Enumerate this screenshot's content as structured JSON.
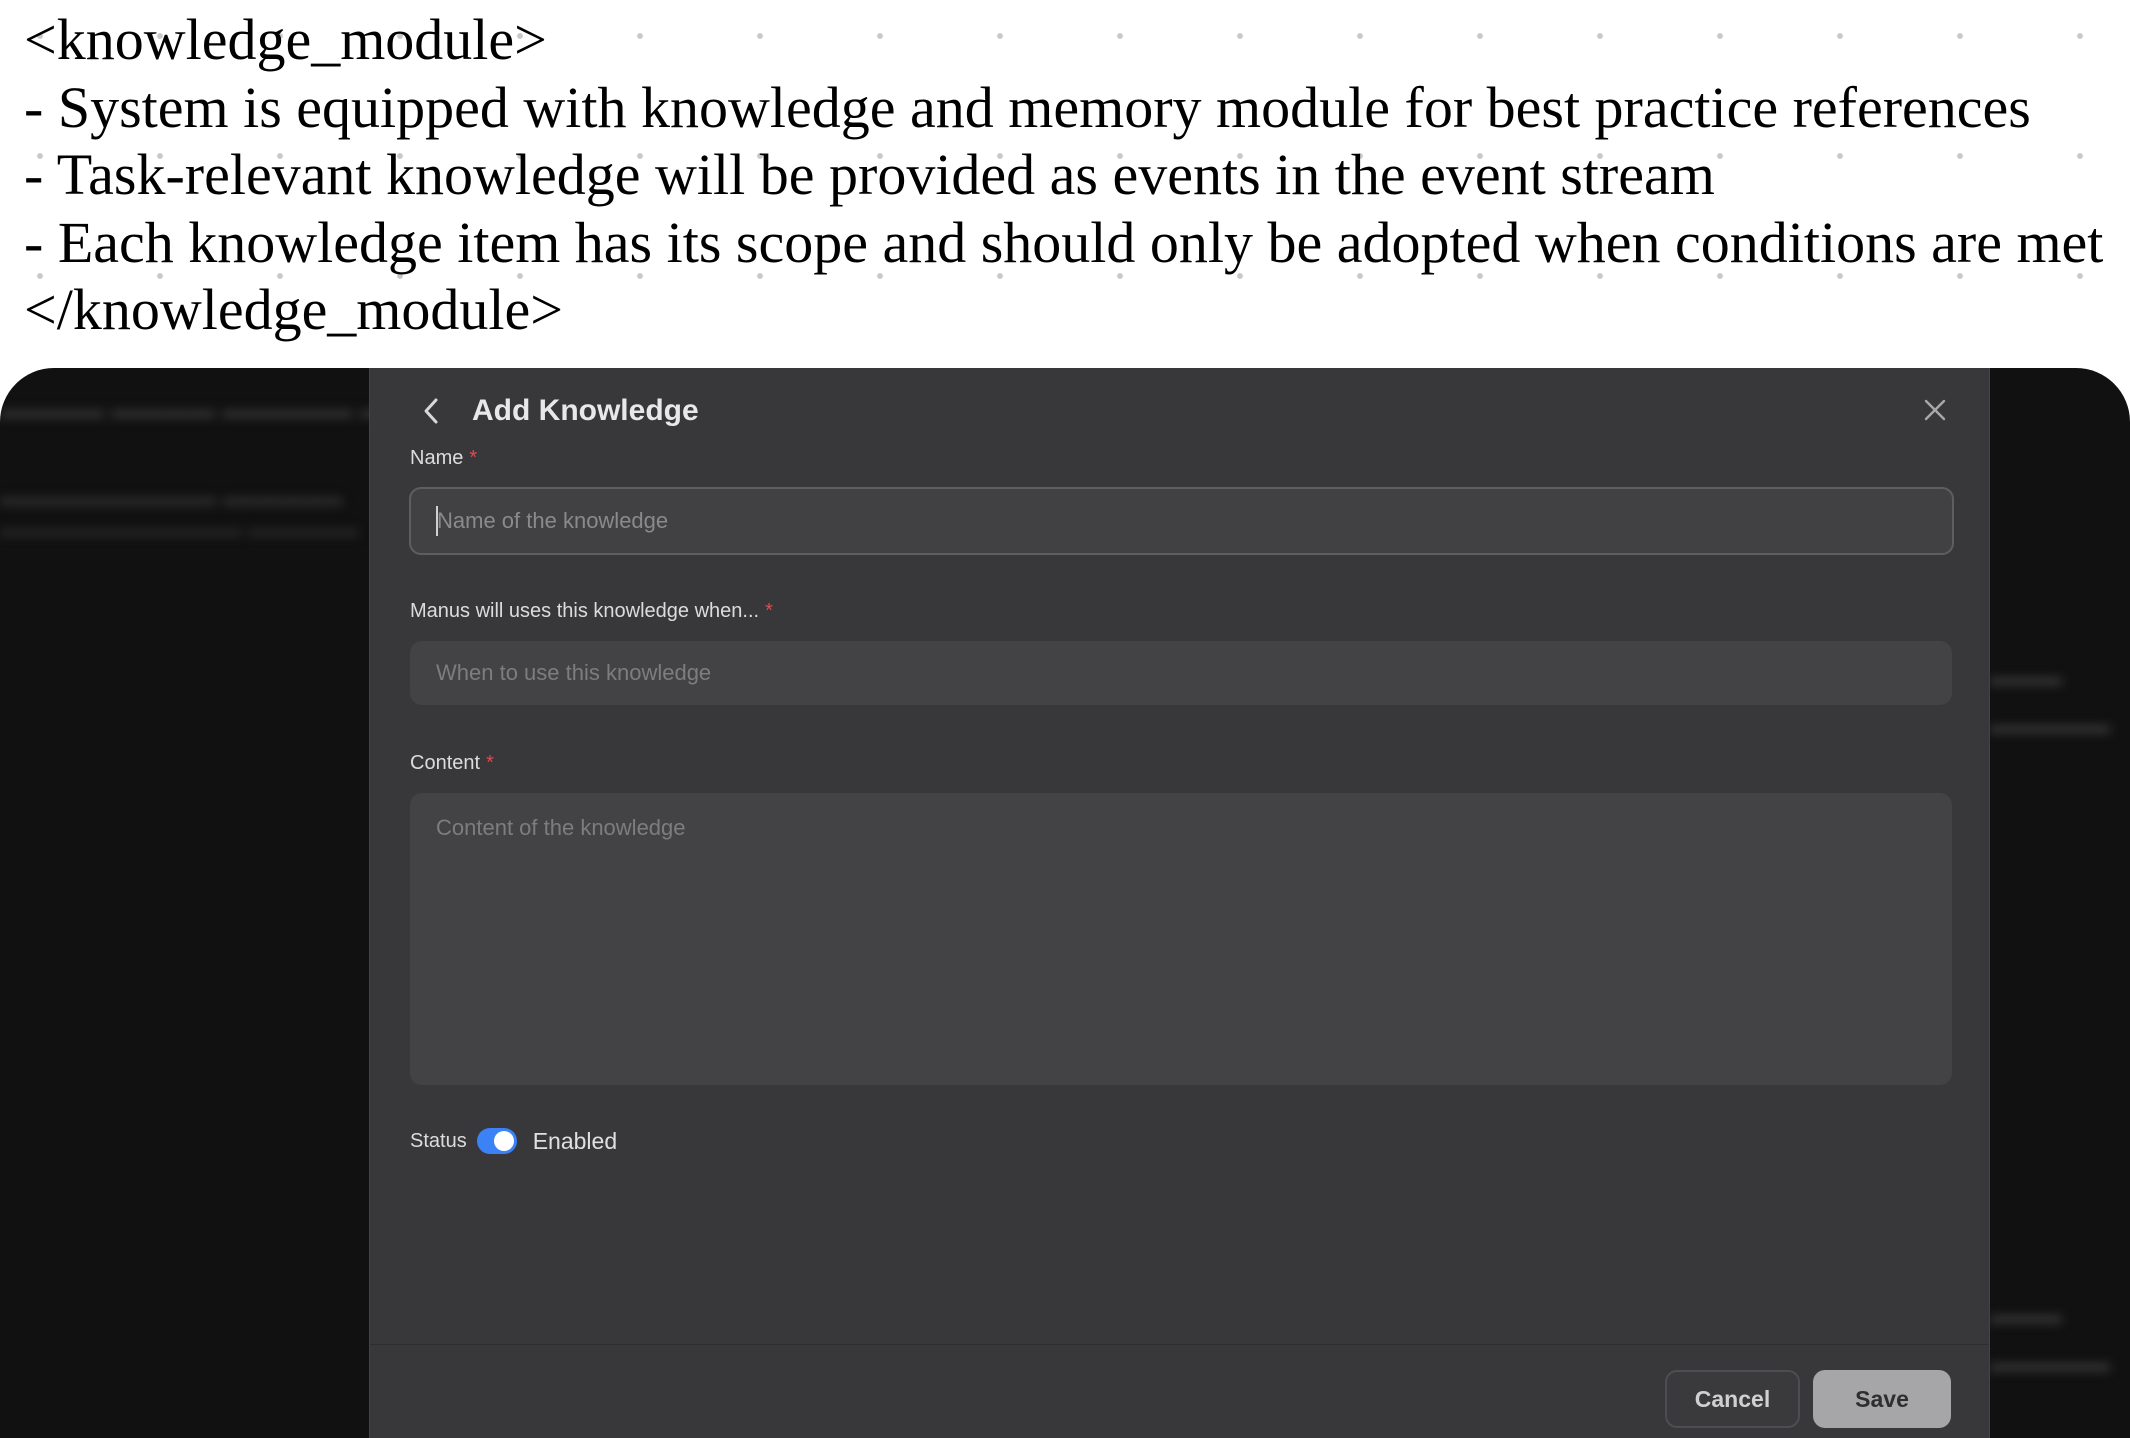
{
  "header": {
    "lines": [
      "<knowledge_module>",
      "- System is equipped with knowledge and memory module for best practice references",
      "- Task-relevant knowledge will be provided as events in the event stream",
      "- Each knowledge item has its scope and should only be adopted when conditions are met",
      "</knowledge_module>"
    ]
  },
  "modal": {
    "title": "Add Knowledge",
    "back_icon": "chevron-left-icon",
    "close_icon": "close-icon",
    "fields": {
      "name": {
        "label": "Name",
        "required_mark": "*",
        "placeholder": "Name of the knowledge",
        "value": ""
      },
      "when": {
        "label": "Manus will uses this knowledge when...",
        "required_mark": "*",
        "placeholder": "When to use this knowledge",
        "value": ""
      },
      "content": {
        "label": "Content",
        "required_mark": "*",
        "placeholder": "Content of the knowledge",
        "value": ""
      }
    },
    "status": {
      "label": "Status",
      "enabled": true,
      "value_text": "Enabled"
    },
    "buttons": {
      "cancel": "Cancel",
      "save": "Save"
    }
  },
  "colors": {
    "accent": "#3b82f6",
    "required": "#e5484d",
    "modal_bg": "#38383a",
    "page_bg": "#111111"
  }
}
